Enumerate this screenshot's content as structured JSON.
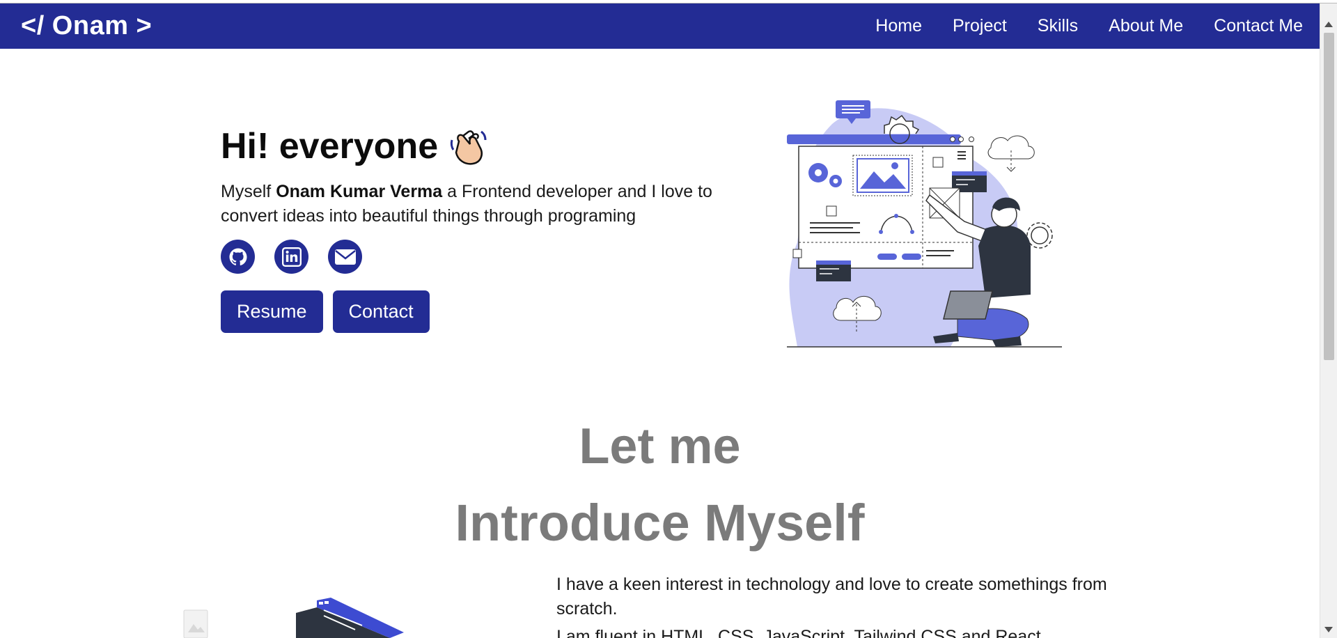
{
  "navbar": {
    "brand": "</ Onam >",
    "links": [
      "Home",
      "Project",
      "Skills",
      "About Me",
      "Contact Me"
    ]
  },
  "hero": {
    "greeting": "Hi! everyone",
    "intro_prefix": "Myself ",
    "intro_name": "Onam Kumar Verma",
    "intro_suffix": " a Frontend developer and I love to convert ideas into beautiful things through programing",
    "socials": [
      "github-icon",
      "linkedin-icon",
      "mail-icon"
    ],
    "buttons": {
      "resume": "Resume",
      "contact": "Contact"
    }
  },
  "about": {
    "title_line1": "Let me",
    "title_line2": "Introduce Myself",
    "paragraph1": "I have a keen interest in technology and love to create somethings from scratch.",
    "paragraph2": "I am fluent in HTML, CSS, JavaScript, Tailwind CSS and React"
  },
  "colors": {
    "primary": "#232c94",
    "title_gray": "#7b7b7b",
    "accent_light": "#c8cbf5"
  }
}
